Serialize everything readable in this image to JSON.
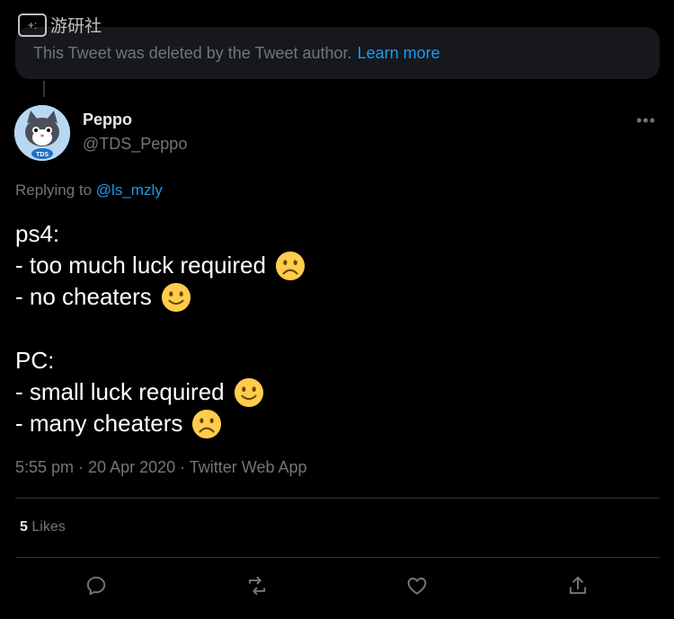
{
  "watermark": {
    "icon_label": "+:",
    "text": "游研社"
  },
  "deleted_notice": {
    "text": "This Tweet was deleted by the Tweet author.",
    "link": "Learn more"
  },
  "tweet": {
    "author_name": "Peppo",
    "author_handle": "@TDS_Peppo",
    "avatar_badge": "TDS",
    "more_label": "•••",
    "replying_prefix": "Replying to",
    "replying_to": "@ls_mzly",
    "body": {
      "line1": "ps4:",
      "line2": "- too much luck required",
      "line3": "- no cheaters",
      "line4": "PC:",
      "line5": "- small luck required",
      "line6": "- many cheaters"
    },
    "meta": "5:55 pm · 20 Apr 2020 · Twitter Web App",
    "likes_count": "5",
    "likes_label": "Likes"
  },
  "icons": {
    "reply": "reply-icon",
    "retweet": "retweet-icon",
    "like": "heart-icon",
    "share": "share-icon"
  },
  "colors": {
    "accent": "#1d9bf0",
    "secondary": "#71767b",
    "background": "#000000"
  }
}
